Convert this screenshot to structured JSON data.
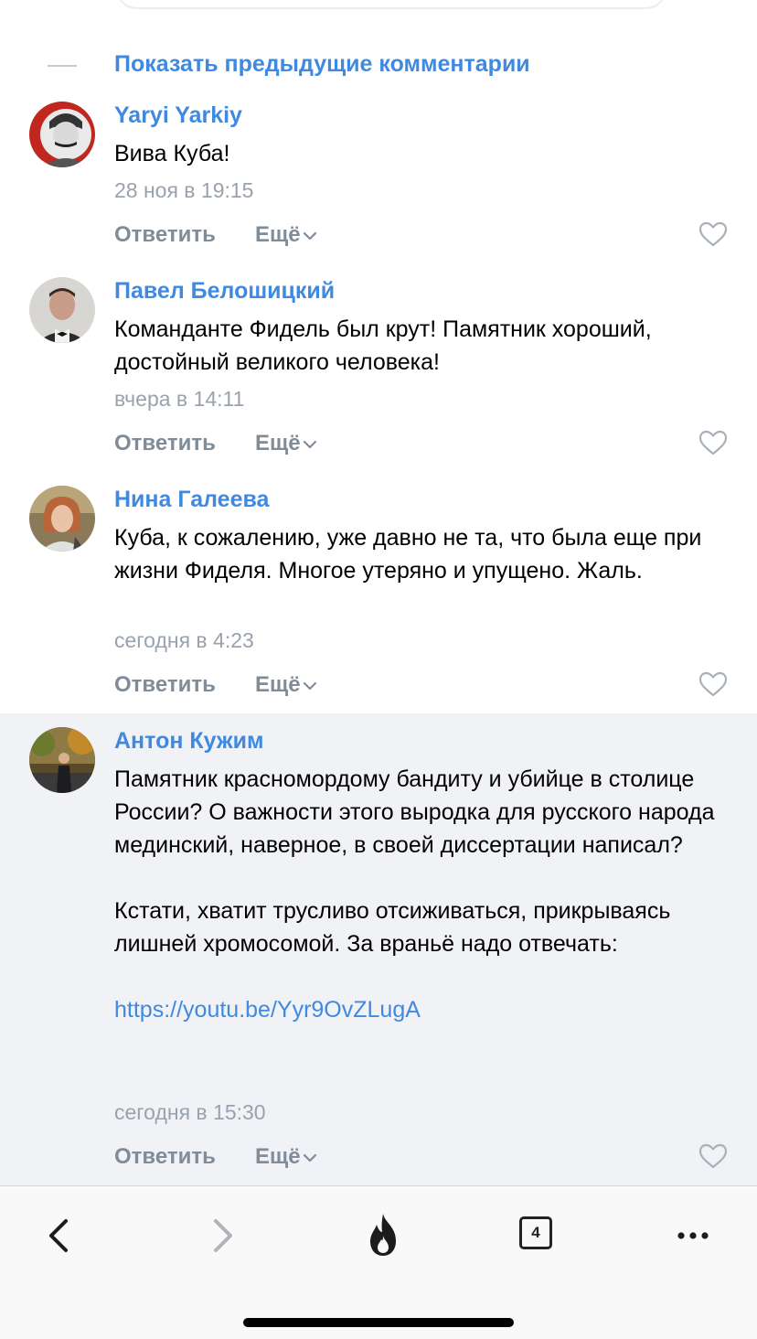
{
  "thread": {
    "show_previous_label": "Показать предыдущие комментарии"
  },
  "actions": {
    "reply_label": "Ответить",
    "more_label": "Ещё"
  },
  "comments": [
    {
      "author": "Yaryi Yarkiy",
      "text": "Вива Куба!",
      "time": "28 ноя в 19:15"
    },
    {
      "author": "Павел Белошицкий",
      "text": "Команданте Фидель был крут! Памятник хороший, достойный великого человека!",
      "time": "вчера в 14:11"
    },
    {
      "author": "Нина Галеева",
      "text": "Куба, к сожалению, уже давно не та, что была еще при жизни Фиделя. Многое утеряно и упущено. Жаль.",
      "time": "сегодня в 4:23"
    },
    {
      "author": "Антон Кужим",
      "text": "Памятник красномордому бандиту и убийце в столице России? О важности этого выродка для русского народа мединский, наверное, в своей диссертации написал?\n\nКстати, хватит трусливо отсиживаться, прикрываясь лишней хромосомой. За враньё надо отвечать:\n\n",
      "link": "https://youtu.be/Yyr9OvZLugA",
      "time": "сегодня в 15:30"
    }
  ],
  "toolbar": {
    "tabs_count": "4",
    "icons": [
      "back-icon",
      "forward-icon",
      "fire-icon",
      "tabs-icon",
      "more-icon"
    ]
  },
  "colors": {
    "link": "#3f8ae0",
    "meta": "#99a2ad",
    "action": "#818c99",
    "highlight_bg": "#f0f2f5"
  }
}
